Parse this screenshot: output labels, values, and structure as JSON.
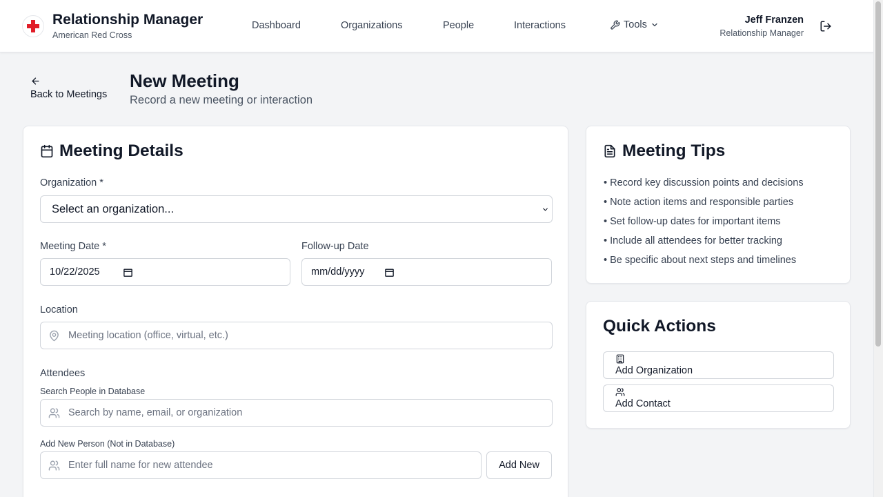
{
  "header": {
    "app_title": "Relationship Manager",
    "org_name": "American Red Cross",
    "nav": [
      "Dashboard",
      "Organizations",
      "People",
      "Interactions"
    ],
    "tools_label": "Tools",
    "user_name": "Jeff Franzen",
    "user_role": "Relationship Manager"
  },
  "page": {
    "back_label": "Back to Meetings",
    "title": "New Meeting",
    "subtitle": "Record a new meeting or interaction"
  },
  "meeting_details": {
    "title": "Meeting Details",
    "organization_label": "Organization *",
    "organization_value": "Select an organization...",
    "meeting_date_label": "Meeting Date *",
    "meeting_date_value": "10/22/2025",
    "followup_label": "Follow-up Date",
    "followup_placeholder": "mm/dd/yyyy",
    "location_label": "Location",
    "location_placeholder": "Meeting location (office, virtual, etc.)",
    "attendees_label": "Attendees",
    "search_people_label": "Search People in Database",
    "search_people_placeholder": "Search by name, email, or organization",
    "add_new_person_label": "Add New Person (Not in Database)",
    "add_new_person_placeholder": "Enter full name for new attendee",
    "add_new_button": "Add New"
  },
  "tips": {
    "title": "Meeting Tips",
    "items": [
      "• Record key discussion points and decisions",
      "• Note action items and responsible parties",
      "• Set follow-up dates for important items",
      "• Include all attendees for better tracking",
      "• Be specific about next steps and timelines"
    ]
  },
  "quick_actions": {
    "title": "Quick Actions",
    "add_organization": "Add Organization",
    "add_contact": "Add Contact"
  },
  "colors": {
    "brand_red": "#e11d28",
    "text_primary": "#111827",
    "text_secondary": "#4b5563",
    "border": "#d1d5db",
    "page_bg": "#f3f4f6"
  }
}
